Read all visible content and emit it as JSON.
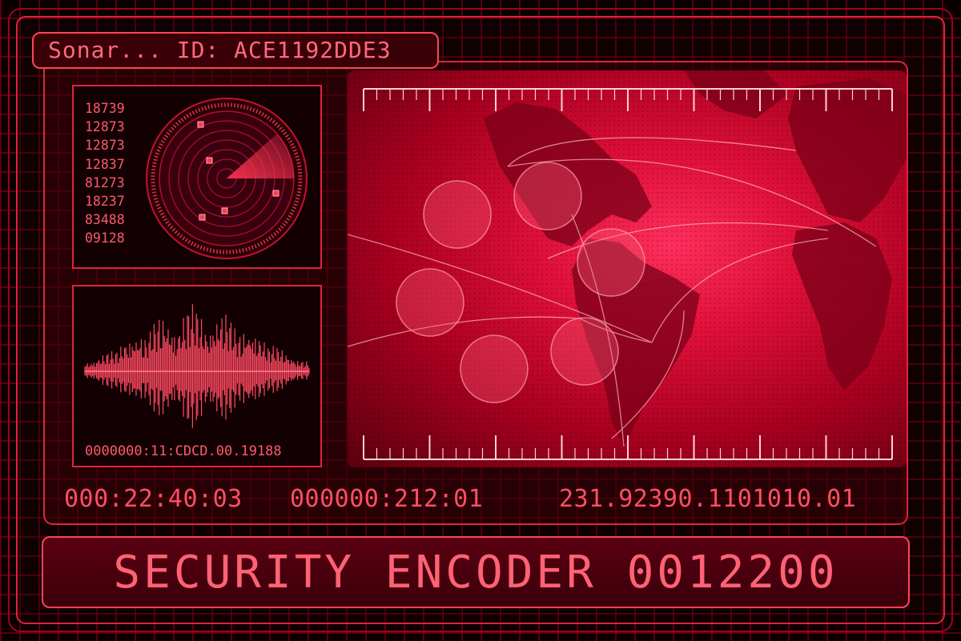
{
  "header": {
    "title": "Sonar... ID: ACE1192DDE3"
  },
  "radar": {
    "numbers": [
      "18739",
      "12873",
      "12873",
      "12837",
      "81273",
      "18237",
      "83488",
      "09128"
    ]
  },
  "waveform": {
    "caption": "0000000:11:CDCD.00.19188"
  },
  "readouts": [
    "000:22:40:03",
    "000000:212:01",
    "231.92390.1101010.01"
  ],
  "banner": {
    "text": "SECURITY ENCODER 0012200"
  },
  "colors": {
    "accent": "#ff4458",
    "text": "#ff5a6a",
    "background": "#0a0002",
    "grid": "#96001a"
  }
}
